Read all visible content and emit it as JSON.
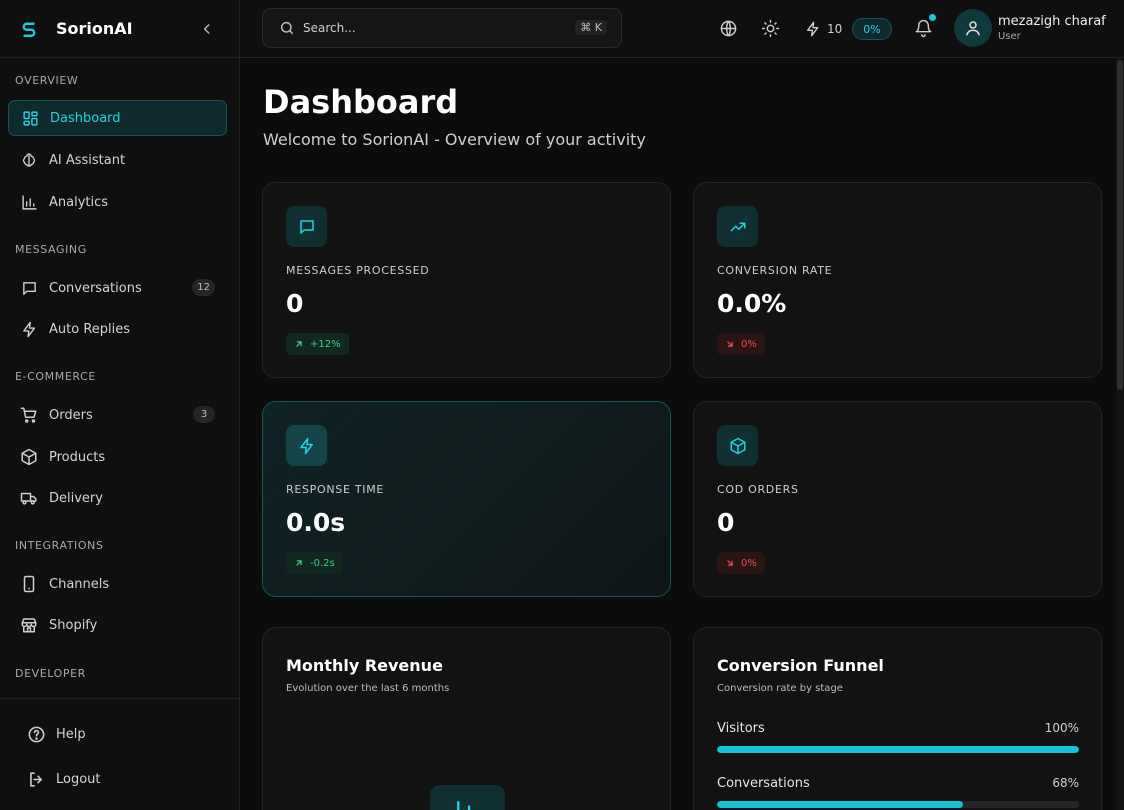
{
  "brand": {
    "name": "SorionAI"
  },
  "sidebar": {
    "sections": [
      {
        "label": "OVERVIEW"
      },
      {
        "label": "MESSAGING"
      },
      {
        "label": "E-COMMERCE"
      },
      {
        "label": "INTEGRATIONS"
      },
      {
        "label": "DEVELOPER"
      }
    ],
    "items": [
      {
        "label": "Dashboard",
        "icon": "grid-icon",
        "active": true
      },
      {
        "label": "AI Assistant",
        "icon": "brain-icon"
      },
      {
        "label": "Analytics",
        "icon": "bar-chart-icon"
      },
      {
        "label": "Conversations",
        "icon": "message-icon",
        "badge": "12"
      },
      {
        "label": "Auto Replies",
        "icon": "bolt-icon"
      },
      {
        "label": "Orders",
        "icon": "cart-icon",
        "badge": "3"
      },
      {
        "label": "Products",
        "icon": "box-icon"
      },
      {
        "label": "Delivery",
        "icon": "truck-icon"
      },
      {
        "label": "Channels",
        "icon": "phone-icon"
      },
      {
        "label": "Shopify",
        "icon": "store-icon"
      }
    ],
    "footer": [
      {
        "label": "Help",
        "icon": "help-icon"
      },
      {
        "label": "Logout",
        "icon": "logout-icon"
      }
    ]
  },
  "topbar": {
    "search_placeholder": "Search...",
    "shortcut": "⌘ K",
    "credits": "10",
    "credits_pct": "0%",
    "user_name": "mezazigh charaf",
    "user_role": "User"
  },
  "page": {
    "title": "Dashboard",
    "subtitle": "Welcome to SorionAI - Overview of your activity"
  },
  "stats": [
    {
      "label": "MESSAGES PROCESSED",
      "value": "0",
      "trend": "+12%",
      "direction": "up",
      "icon": "message-icon"
    },
    {
      "label": "CONVERSION RATE",
      "value": "0.0%",
      "trend": "0%",
      "direction": "down",
      "icon": "trending-up-icon"
    },
    {
      "label": "RESPONSE TIME",
      "value": "0.0s",
      "trend": "-0.2s",
      "direction": "up",
      "icon": "bolt-icon"
    },
    {
      "label": "COD ORDERS",
      "value": "0",
      "trend": "0%",
      "direction": "down",
      "icon": "package-icon"
    }
  ],
  "revenue": {
    "title": "Monthly Revenue",
    "subtitle": "Evolution over the last 6 months"
  },
  "funnel": {
    "title": "Conversion Funnel",
    "subtitle": "Conversion rate by stage",
    "stages": [
      {
        "label": "Visitors",
        "pct_label": "100%",
        "value": 100
      },
      {
        "label": "Conversations",
        "pct_label": "68%",
        "value": 68
      }
    ]
  },
  "colors": {
    "accent": "#22d3e4",
    "positive": "#3ad08a",
    "negative": "#ef4b4b"
  }
}
